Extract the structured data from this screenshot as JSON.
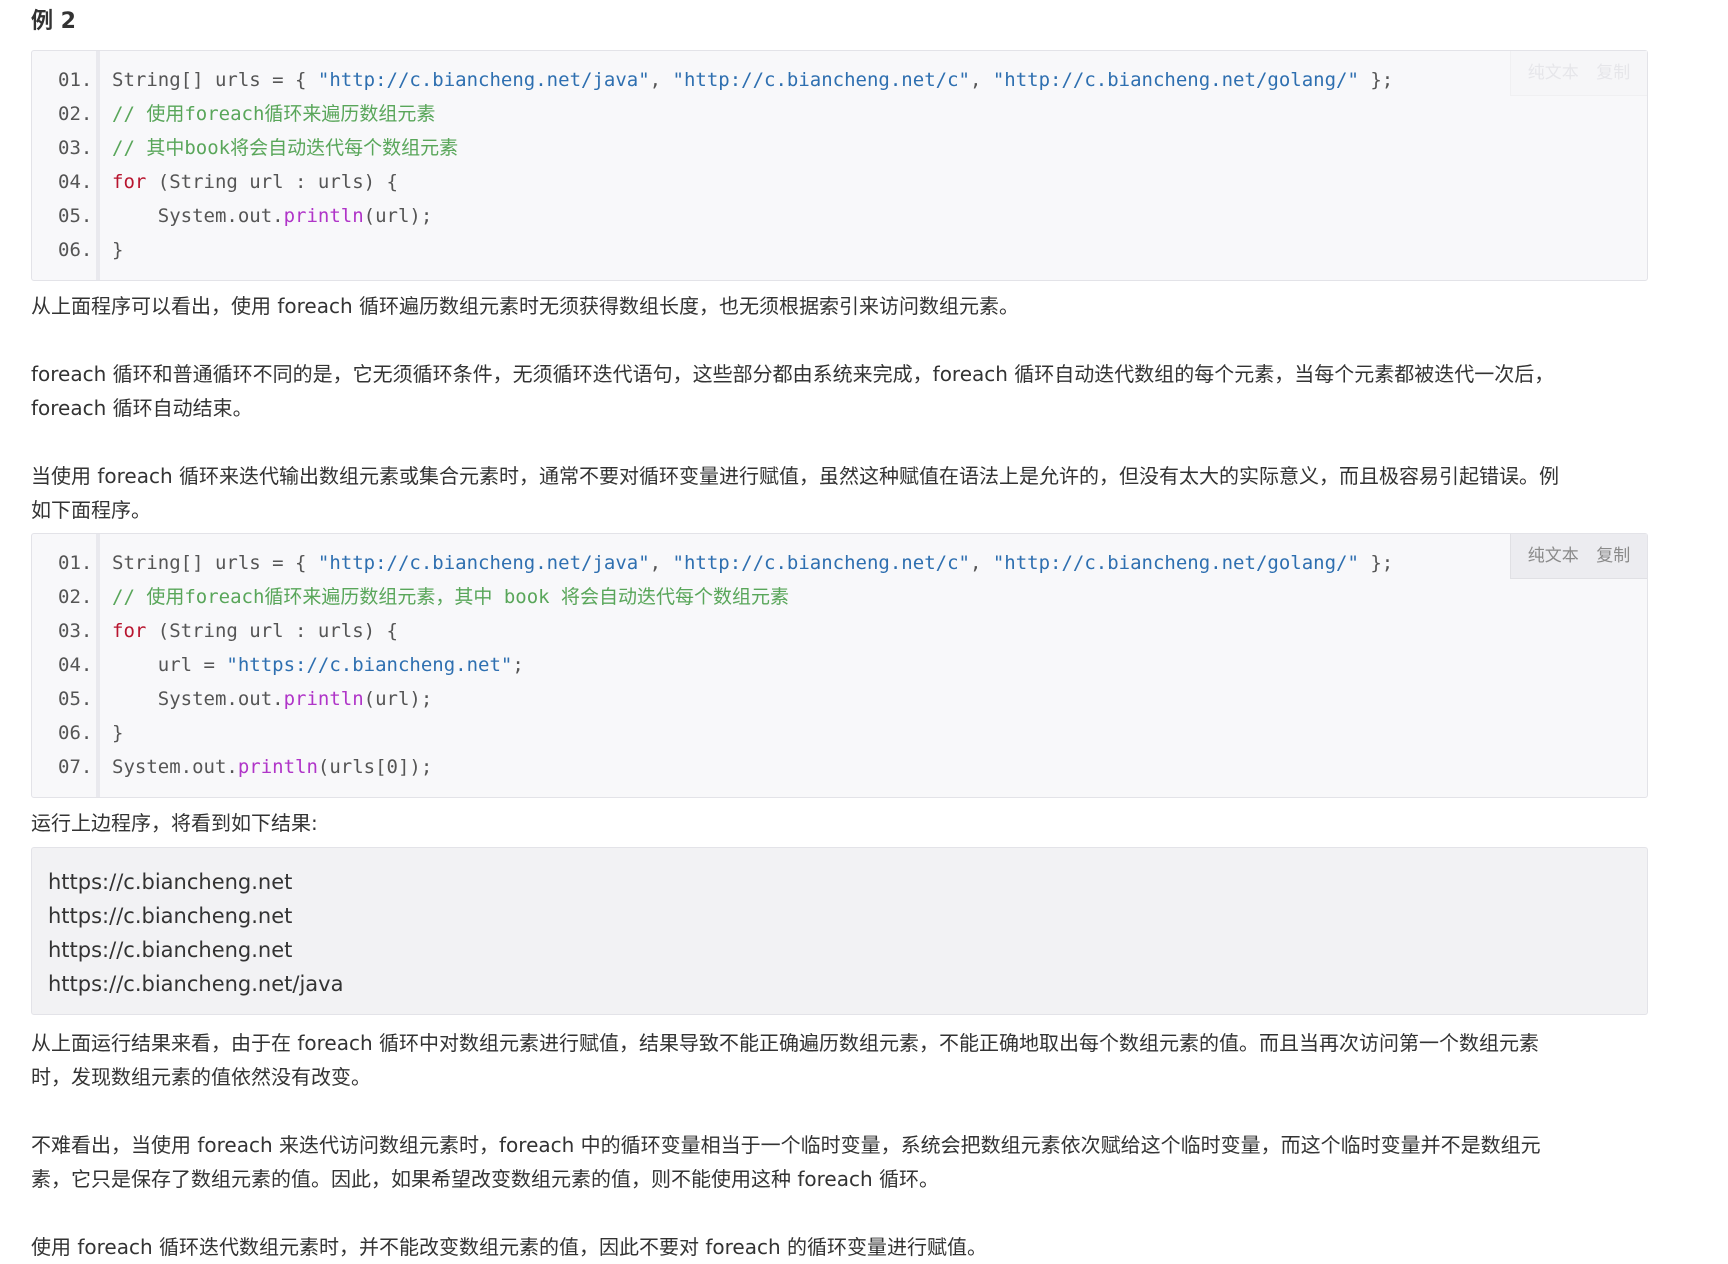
{
  "heading": "例 2",
  "code_block_1": {
    "tools": {
      "plain": "纯文本",
      "copy": "复制"
    },
    "lines": [
      {
        "n": "01.",
        "parts": [
          {
            "t": "String[] urls = { ",
            "c": ""
          },
          {
            "t": "\"http://c.biancheng.net/java\"",
            "c": "str"
          },
          {
            "t": ", ",
            "c": ""
          },
          {
            "t": "\"http://c.biancheng.net/c\"",
            "c": "str"
          },
          {
            "t": ", ",
            "c": ""
          },
          {
            "t": "\"http://c.biancheng.net/golang/\"",
            "c": "str"
          },
          {
            "t": " };",
            "c": ""
          }
        ]
      },
      {
        "n": "02.",
        "parts": [
          {
            "t": "// 使用foreach循环来遍历数组元素",
            "c": "cmt"
          }
        ]
      },
      {
        "n": "03.",
        "parts": [
          {
            "t": "// 其中book将会自动迭代每个数组元素",
            "c": "cmt"
          }
        ]
      },
      {
        "n": "04.",
        "parts": [
          {
            "t": "for",
            "c": "kw"
          },
          {
            "t": " (String url : urls) {",
            "c": ""
          }
        ]
      },
      {
        "n": "05.",
        "parts": [
          {
            "t": "    System.out.",
            "c": ""
          },
          {
            "t": "println",
            "c": "fn"
          },
          {
            "t": "(url);",
            "c": ""
          }
        ]
      },
      {
        "n": "06.",
        "parts": [
          {
            "t": "}",
            "c": ""
          }
        ]
      }
    ]
  },
  "paragraphs_1": [
    "从上面程序可以看出，使用 foreach 循环遍历数组元素时无须获得数组长度，也无须根据索引来访问数组元素。",
    "foreach 循环和普通循环不同的是，它无须循环条件，无须循环迭代语句，这些部分都由系统来完成，foreach 循环自动迭代数组的每个元素，当每个元素都被迭代一次后，",
    "foreach 循环自动结束。",
    "当使用 foreach 循环来迭代输出数组元素或集合元素时，通常不要对循环变量进行赋值，虽然这种赋值在语法上是允许的，但没有太大的实际意义，而且极容易引起错误。例",
    "如下面程序。"
  ],
  "code_block_2": {
    "tools": {
      "plain": "纯文本",
      "copy": "复制"
    },
    "lines": [
      {
        "n": "01.",
        "parts": [
          {
            "t": "String[] urls = { ",
            "c": ""
          },
          {
            "t": "\"http://c.biancheng.net/java\"",
            "c": "str"
          },
          {
            "t": ", ",
            "c": ""
          },
          {
            "t": "\"http://c.biancheng.net/c\"",
            "c": "str"
          },
          {
            "t": ", ",
            "c": ""
          },
          {
            "t": "\"http://c.biancheng.net/golang/\"",
            "c": "str"
          },
          {
            "t": " };",
            "c": ""
          }
        ]
      },
      {
        "n": "02.",
        "parts": [
          {
            "t": "// 使用foreach循环来遍历数组元素，其中 book 将会自动迭代每个数组元素",
            "c": "cmt"
          }
        ]
      },
      {
        "n": "03.",
        "parts": [
          {
            "t": "for",
            "c": "kw"
          },
          {
            "t": " (String url : urls) {",
            "c": ""
          }
        ]
      },
      {
        "n": "04.",
        "parts": [
          {
            "t": "    url = ",
            "c": ""
          },
          {
            "t": "\"https://c.biancheng.net\"",
            "c": "str"
          },
          {
            "t": ";",
            "c": ""
          }
        ]
      },
      {
        "n": "05.",
        "parts": [
          {
            "t": "    System.out.",
            "c": ""
          },
          {
            "t": "println",
            "c": "fn"
          },
          {
            "t": "(url);",
            "c": ""
          }
        ]
      },
      {
        "n": "06.",
        "parts": [
          {
            "t": "}",
            "c": ""
          }
        ]
      },
      {
        "n": "07.",
        "parts": [
          {
            "t": "System.out.",
            "c": ""
          },
          {
            "t": "println",
            "c": "fn"
          },
          {
            "t": "(urls[0]);",
            "c": ""
          }
        ]
      }
    ]
  },
  "run_intro": "运行上边程序，将看到如下结果:",
  "output_lines": [
    "https://c.biancheng.net",
    "https://c.biancheng.net",
    "https://c.biancheng.net",
    "https://c.biancheng.net/java"
  ],
  "paragraphs_2": [
    "从上面运行结果来看，由于在 foreach 循环中对数组元素进行赋值，结果导致不能正确遍历数组元素，不能正确地取出每个数组元素的值。而且当再次访问第一个数组元素",
    "时，发现数组元素的值依然没有改变。",
    "不难看出，当使用 foreach 来迭代访问数组元素时，foreach 中的循环变量相当于一个临时变量，系统会把数组元素依次赋给这个临时变量，而这个临时变量并不是数组元",
    "素，它只是保存了数组元素的值。因此，如果希望改变数组元素的值，则不能使用这种 foreach 循环。",
    "使用 foreach 循环迭代数组元素时，并不能改变数组元素的值，因此不要对 foreach 的循环变量进行赋值。"
  ],
  "colors": {
    "string": "#2e6fb0",
    "comment": "#59a65a",
    "keyword": "#b8152f",
    "method": "#b035c8"
  }
}
